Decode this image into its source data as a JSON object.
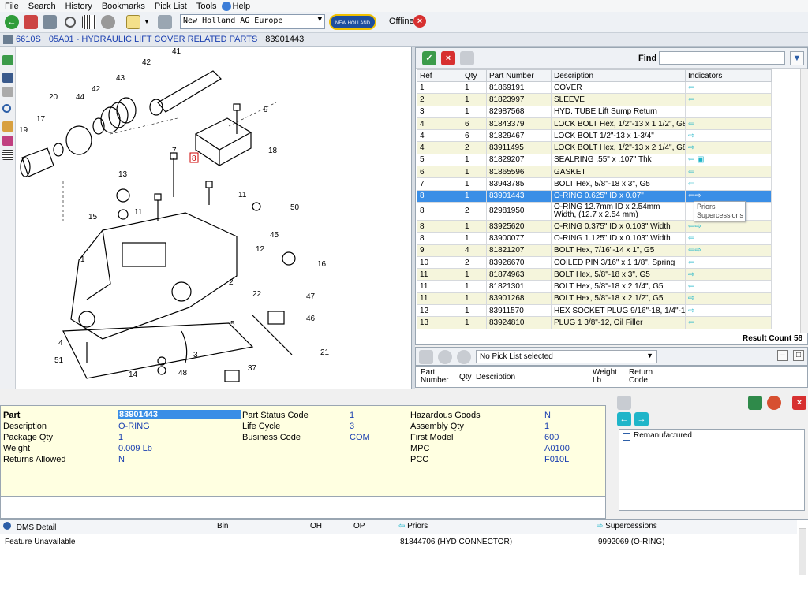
{
  "menu": [
    "File",
    "Search",
    "History",
    "Bookmarks",
    "Pick List",
    "Tools",
    "Help"
  ],
  "toolbar": {
    "region": "New Holland AG Europe",
    "logo_text": "NEW HOLLAND AGRICULTURE",
    "offline_label": "Offline"
  },
  "breadcrumb": {
    "model": "6610S",
    "section": "05A01 - HYDRAULIC LIFT COVER  RELATED PARTS",
    "part_number": "83901443"
  },
  "diagram": {
    "callouts": [
      "41",
      "42",
      "43",
      "42",
      "44",
      "20",
      "17",
      "19",
      "9",
      "18",
      "7",
      "8",
      "13",
      "11",
      "11",
      "15",
      "50",
      "45",
      "1",
      "12",
      "16",
      "2",
      "22",
      "47",
      "5",
      "46",
      "3",
      "4",
      "51",
      "14",
      "48",
      "21",
      "37"
    ]
  },
  "parts_panel": {
    "find_label": "Find",
    "find_value": "",
    "columns": [
      "Ref",
      "Qty",
      "Part Number",
      "Description",
      "Indicators"
    ],
    "rows": [
      {
        "ref": "1",
        "qty": "1",
        "part": "81869191",
        "desc": "COVER",
        "ind": "⇦"
      },
      {
        "ref": "2",
        "qty": "1",
        "part": "81823997",
        "desc": "SLEEVE",
        "ind": "⇦"
      },
      {
        "ref": "3",
        "qty": "1",
        "part": "82987568",
        "desc": "HYD. TUBE Lift Sump Return",
        "ind": ""
      },
      {
        "ref": "4",
        "qty": "6",
        "part": "81843379",
        "desc": "LOCK BOLT Hex, 1/2\"-13 x 1 1/2\", G8",
        "ind": "⇦"
      },
      {
        "ref": "4",
        "qty": "6",
        "part": "81829467",
        "desc": "LOCK BOLT 1/2\"-13 x 1-3/4\"",
        "ind": "  ⇨"
      },
      {
        "ref": "4",
        "qty": "2",
        "part": "83911495",
        "desc": "LOCK BOLT Hex, 1/2\"-13 x 2 1/4\", G8",
        "ind": "  ⇨"
      },
      {
        "ref": "5",
        "qty": "1",
        "part": "81829207",
        "desc": "SEALRING .55\" x .107\" Thk",
        "ind": "⇦ ▣"
      },
      {
        "ref": "6",
        "qty": "1",
        "part": "81865596",
        "desc": "GASKET",
        "ind": "⇦"
      },
      {
        "ref": "7",
        "qty": "1",
        "part": "83943785",
        "desc": "BOLT Hex, 5/8\"-18 x 3\", G5",
        "ind": "⇦"
      },
      {
        "ref": "8",
        "qty": "1",
        "part": "83901443",
        "desc": "O-RING 0.625\" ID x 0.07\"",
        "ind": "⇦⇨"
      },
      {
        "ref": "8",
        "qty": "2",
        "part": "82981950",
        "desc": "O-RING 12.7mm ID x 2.54mm Width, (12.7 x 2.54 mm)",
        "ind": ""
      },
      {
        "ref": "8",
        "qty": "1",
        "part": "83925620",
        "desc": "O-RING 0.375\" ID x 0.103\" Width",
        "ind": "⇦⇨"
      },
      {
        "ref": "8",
        "qty": "1",
        "part": "83900077",
        "desc": "O-RING 1.125\" ID x 0.103\" Width",
        "ind": "⇦"
      },
      {
        "ref": "9",
        "qty": "4",
        "part": "81821207",
        "desc": "BOLT Hex, 7/16\"-14 x 1\", G5",
        "ind": "⇦⇨"
      },
      {
        "ref": "10",
        "qty": "2",
        "part": "83926670",
        "desc": "COILED PIN 3/16\" x 1 1/8\", Spring",
        "ind": "⇦"
      },
      {
        "ref": "11",
        "qty": "1",
        "part": "81874963",
        "desc": "BOLT Hex, 5/8\"-18 x 3\", G5",
        "ind": "  ⇨"
      },
      {
        "ref": "11",
        "qty": "1",
        "part": "81821301",
        "desc": "BOLT Hex, 5/8\"-18 x 2 1/4\", G5",
        "ind": "⇦"
      },
      {
        "ref": "11",
        "qty": "1",
        "part": "83901268",
        "desc": "BOLT Hex, 5/8\"-18 x 2 1/2\", G5",
        "ind": "  ⇨"
      },
      {
        "ref": "12",
        "qty": "1",
        "part": "83911570",
        "desc": "HEX SOCKET PLUG 9/16\"-18, 1/4\"-18",
        "ind": "  ⇨"
      },
      {
        "ref": "13",
        "qty": "1",
        "part": "83924810",
        "desc": "PLUG 1 3/8\"-12, Oil Filler",
        "ind": "⇦"
      }
    ],
    "tooltip": [
      "Priors",
      "Supercessions"
    ],
    "result_count": "Result Count 58"
  },
  "picklist": {
    "selected": "No Pick List selected",
    "columns": [
      "Part Number",
      "Qty",
      "Description",
      "Weight Lb",
      "Return Code"
    ]
  },
  "details": {
    "col1": [
      {
        "k": "Part",
        "v": "83901443"
      },
      {
        "k": "Description",
        "v": "O-RING"
      },
      {
        "k": "Package Qty",
        "v": "1"
      },
      {
        "k": "Weight",
        "v": "0.009 Lb"
      },
      {
        "k": "Returns Allowed",
        "v": "N"
      }
    ],
    "col2": [
      {
        "k": "Part Status Code",
        "v": "1"
      },
      {
        "k": "Life Cycle",
        "v": "3"
      },
      {
        "k": "Business Code",
        "v": "COM"
      }
    ],
    "col3": [
      {
        "k": "Hazardous Goods",
        "v": "N"
      },
      {
        "k": "Assembly Qty",
        "v": "1"
      },
      {
        "k": "First Model",
        "v": "600"
      },
      {
        "k": "MPC",
        "v": "A0100"
      },
      {
        "k": "PCC",
        "v": "F010L"
      }
    ]
  },
  "side_panel": {
    "remanufactured_label": "Remanufactured"
  },
  "bottom": {
    "dms_title": "DMS Detail",
    "bin": "Bin",
    "oh": "OH",
    "op": "OP",
    "dms_value": "Feature Unavailable",
    "priors_title": "Priors",
    "priors_value": "81844706 (HYD CONNECTOR)",
    "supercessions_title": "Supercessions",
    "supercessions_value": "9992069 (O-RING)"
  }
}
